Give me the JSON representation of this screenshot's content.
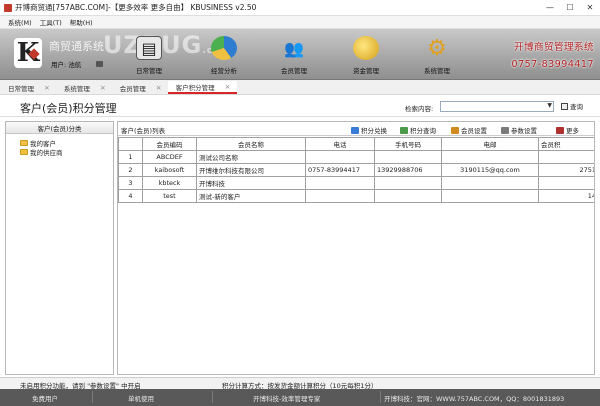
{
  "window": {
    "title": "开博商贸通[757ABC.COM]-【更多效率 更多自由】  KBUSINESS v2.50",
    "controls": [
      "—",
      "☐",
      "✕"
    ]
  },
  "menu": [
    "系统(M)",
    "工具(T)",
    "帮助(H)"
  ],
  "banner": {
    "logo_letter": "K",
    "brand_name": "商贸通系统",
    "user_label": "用户: 池航",
    "watermark": "UZBUG",
    "watermark_suffix": ".com",
    "nav": [
      {
        "label": "日常管理",
        "icon": "notebook-icon"
      },
      {
        "label": "经营分析",
        "icon": "pie-chart-icon"
      },
      {
        "label": "会员管理",
        "icon": "members-icon"
      },
      {
        "label": "资金管理",
        "icon": "coins-icon"
      },
      {
        "label": "系统管理",
        "icon": "gear-icon"
      }
    ],
    "contact_line1": "开博商贸管理系统",
    "contact_line2": "0757-83994417"
  },
  "tabs": [
    {
      "label": "日常管理",
      "active": false
    },
    {
      "label": "系统管理",
      "active": false
    },
    {
      "label": "会员管理",
      "active": false
    },
    {
      "label": "客户积分管理",
      "active": true
    }
  ],
  "page": {
    "title": "客户(会员)积分管理",
    "search_label": "检索内容:",
    "search_value": "",
    "query_label": "查询"
  },
  "left_panel": {
    "header": "客户(会员)分类",
    "items": [
      "我的客户",
      "我的供应商"
    ]
  },
  "right_panel": {
    "header": "客户(会员)列表",
    "toolbar": [
      {
        "label": "积分兑换",
        "icon": "exchange-icon",
        "color": "#3a7bd5"
      },
      {
        "label": "积分查询",
        "icon": "lookup-icon",
        "color": "#4a9a4a"
      },
      {
        "label": "会员设置",
        "icon": "member-settings-icon",
        "color": "#d08a20"
      },
      {
        "label": "参数设置",
        "icon": "params-icon",
        "color": "#7a7a7a"
      },
      {
        "label": "更多",
        "icon": "tools-icon",
        "color": "#b03030"
      }
    ],
    "columns": [
      "",
      "会员编码",
      "会员名称",
      "电话",
      "手机号码",
      "电邮",
      "会员积"
    ],
    "rows": [
      [
        "1",
        "ABCDEF",
        "测试公司名称",
        "",
        "",
        "",
        ""
      ],
      [
        "2",
        "kaibosoft",
        "开博维尔科技有限公司",
        "0757-83994417",
        "13929988706",
        "3190115@qq.com",
        "2751"
      ],
      [
        "3",
        "kbteck",
        "开博科技",
        "",
        "",
        "",
        ""
      ],
      [
        "4",
        "test",
        "测试-新的客户",
        "",
        "",
        "",
        "14"
      ]
    ]
  },
  "status": {
    "left": "未启用积分功能，请到 \"参数设置\" 中开启",
    "right": "积分计算方式：按发货金额计算积分（10元每积1分）",
    "bottom": [
      "免费用户",
      "单机使用",
      "开博科技-效率管理专家",
      "开博科技：官网：WWW.757ABC.COM，QQ：8001831893"
    ]
  },
  "colors": {
    "accent": "#d9242b",
    "contact": "#b02020",
    "statusbar": "#595959"
  }
}
